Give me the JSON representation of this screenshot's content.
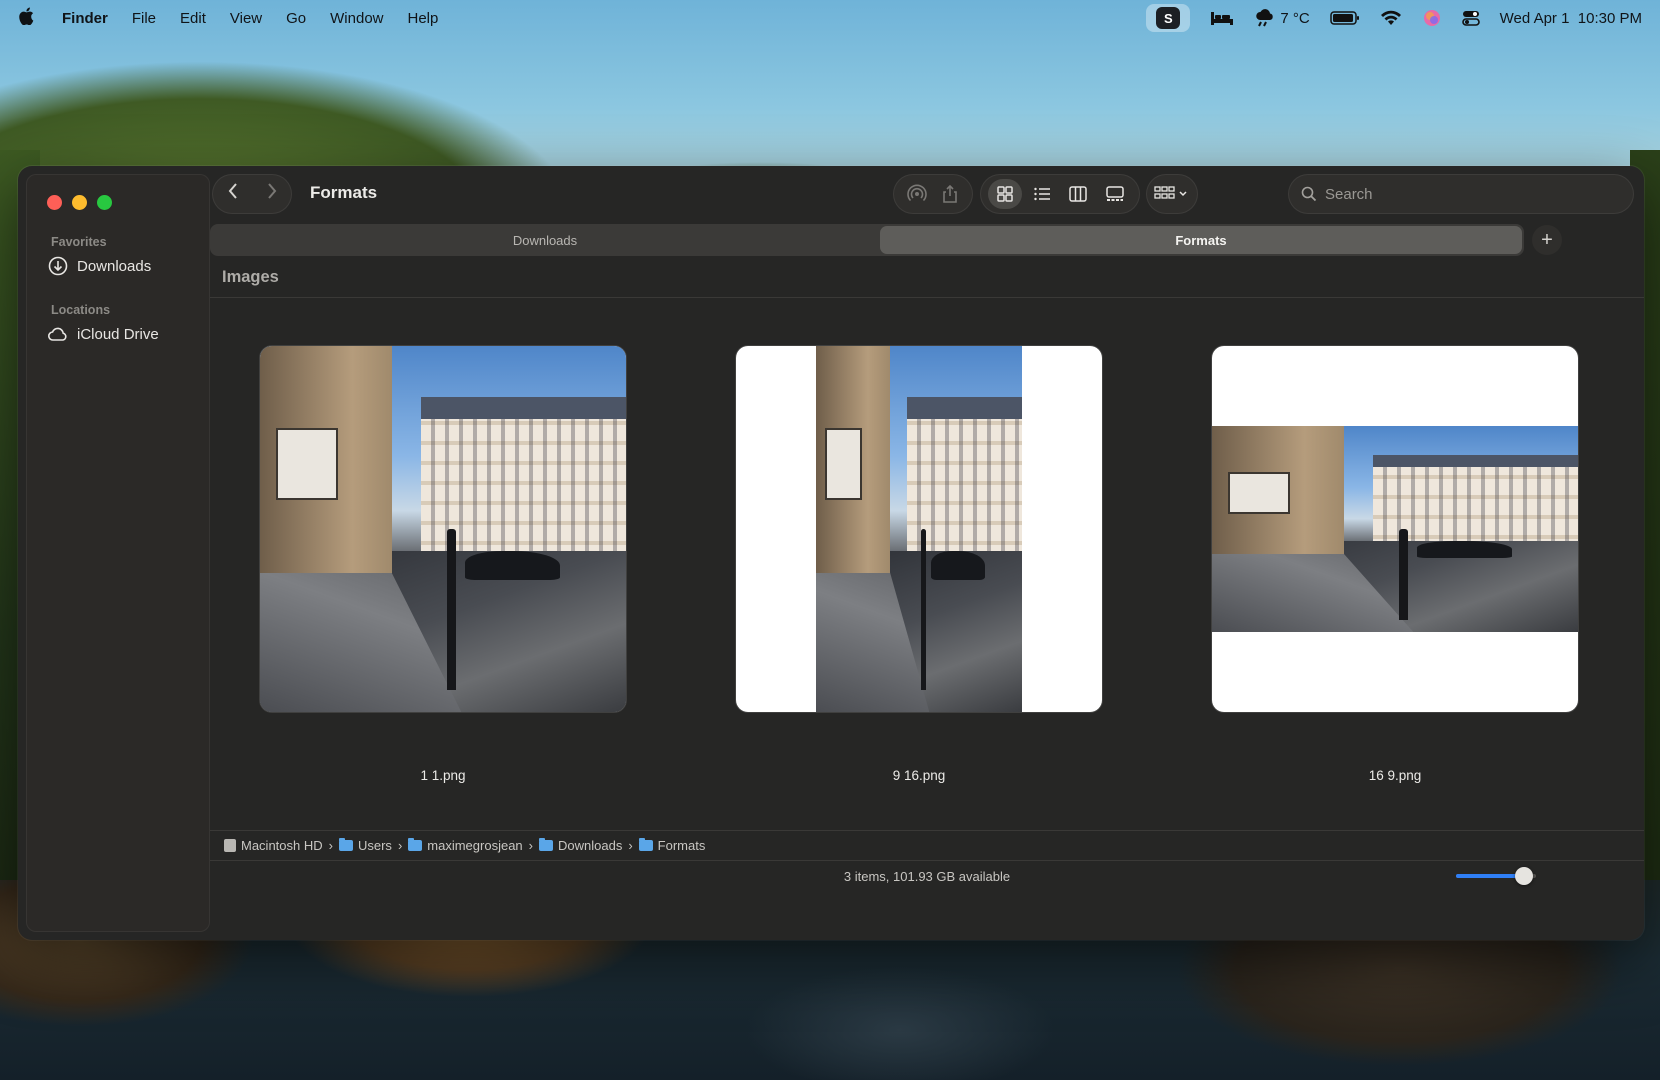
{
  "menubar": {
    "app_name": "Finder",
    "menus": [
      "File",
      "Edit",
      "View",
      "Go",
      "Window",
      "Help"
    ],
    "status": {
      "s_badge": "S",
      "weather": "7 °C",
      "date": "Wed Apr 1",
      "time": "10:30 PM"
    }
  },
  "window": {
    "title": "Formats",
    "search_placeholder": "Search",
    "tabs": [
      {
        "label": "Downloads",
        "active": false
      },
      {
        "label": "Formats",
        "active": true
      }
    ],
    "add_tab_label": "+",
    "group_title": "Images"
  },
  "sidebar": {
    "favorites_title": "Favorites",
    "favorites": [
      {
        "label": "Downloads",
        "icon": "download-circle-icon"
      }
    ],
    "locations_title": "Locations",
    "locations": [
      {
        "label": "iCloud Drive",
        "icon": "cloud-icon"
      }
    ]
  },
  "files": [
    {
      "name": "1 1.png",
      "aspect": "1:1"
    },
    {
      "name": "9 16.png",
      "aspect": "9:16"
    },
    {
      "name": "16 9.png",
      "aspect": "16:9"
    }
  ],
  "pathbar": {
    "crumbs": [
      "Macintosh HD",
      "Users",
      "maximegrosjean",
      "Downloads",
      "Formats"
    ],
    "separator": "›"
  },
  "statusbar": {
    "text": "3 items, 101.93 GB available",
    "icon_size_level": 0.85
  },
  "colors": {
    "accent": "#2f7ff6",
    "window_bg": "#262625",
    "close": "#fe5f57",
    "minimize": "#febc2e",
    "zoom": "#28c840"
  }
}
